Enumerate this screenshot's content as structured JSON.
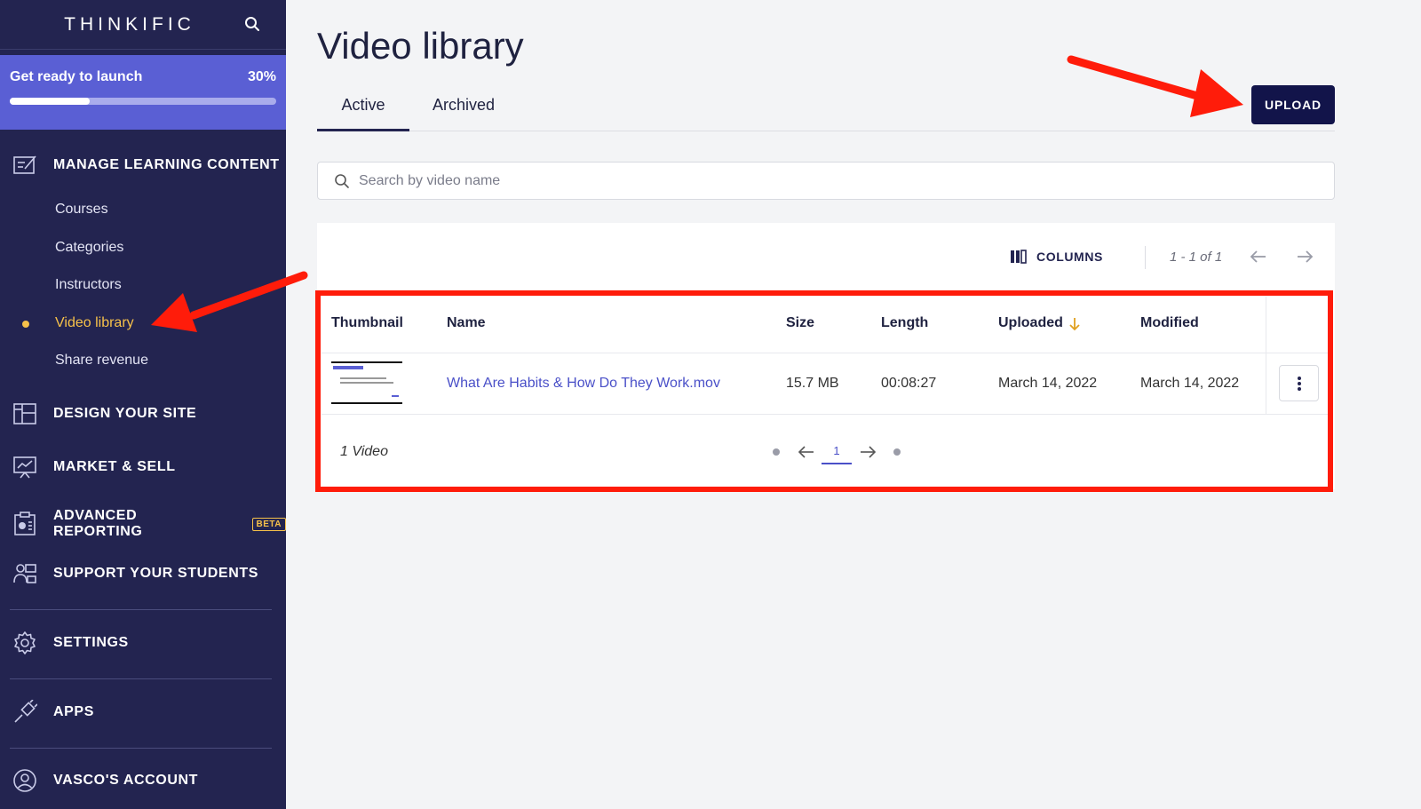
{
  "sidebar": {
    "brand": "THINKIFIC",
    "launch": {
      "label": "Get ready to launch",
      "percent_text": "30%",
      "progress": 0.3
    },
    "sections": [
      {
        "label": "MANAGE LEARNING CONTENT",
        "icon": "edit-content-icon"
      },
      {
        "label": "DESIGN YOUR SITE",
        "icon": "layout-icon"
      },
      {
        "label": "MARKET & SELL",
        "icon": "chart-board-icon"
      },
      {
        "label": "ADVANCED REPORTING",
        "icon": "report-icon",
        "badge": "BETA"
      },
      {
        "label": "SUPPORT YOUR STUDENTS",
        "icon": "students-icon"
      },
      {
        "label": "SETTINGS",
        "icon": "gear-icon"
      },
      {
        "label": "APPS",
        "icon": "plug-icon"
      },
      {
        "label": "VASCO'S ACCOUNT",
        "icon": "account-icon"
      }
    ],
    "sub_items": [
      "Courses",
      "Categories",
      "Instructors",
      "Video library",
      "Share revenue"
    ]
  },
  "main": {
    "title": "Video library",
    "tabs": [
      "Active",
      "Archived"
    ],
    "upload_label": "UPLOAD",
    "search_placeholder": "Search by video name",
    "columns_label": "COLUMNS",
    "pager_count": "1 - 1 of 1",
    "table": {
      "headers": [
        "Thumbnail",
        "Name",
        "Size",
        "Length",
        "Uploaded",
        "Modified"
      ],
      "rows": [
        {
          "name": "What Are Habits & How Do They Work.mov",
          "size": "15.7 MB",
          "length": "00:08:27",
          "uploaded": "March 14, 2022",
          "modified": "March 14, 2022"
        }
      ]
    },
    "footer_count": "1 Video",
    "current_page": "1"
  },
  "colors": {
    "sidebar": "#232450",
    "accent": "#5a5fd4",
    "active": "#f6c14a",
    "annotation": "#ff1c0a"
  }
}
